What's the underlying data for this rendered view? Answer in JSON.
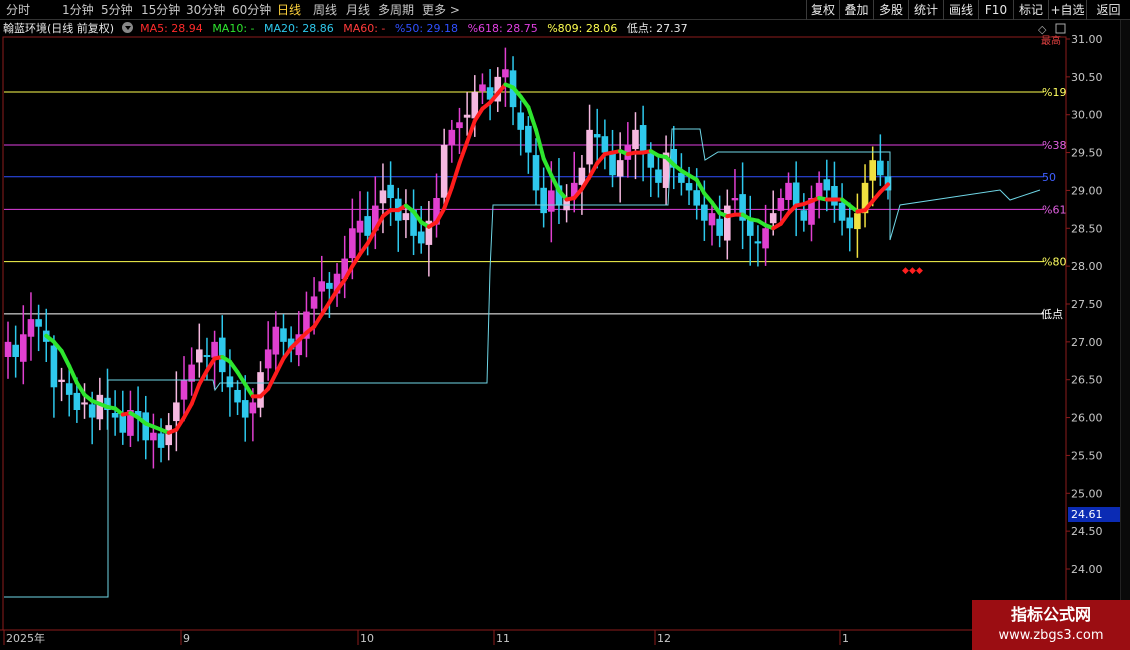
{
  "toolbar": {
    "periods": [
      "分时",
      "1分钟",
      "5分钟",
      "15分钟",
      "30分钟",
      "60分钟",
      "日线",
      "周线",
      "月线",
      "多周期",
      "更多 >"
    ],
    "active_period": "日线",
    "buttons": [
      "复权",
      "叠加",
      "多股",
      "统计",
      "画线",
      "F10",
      "标记",
      "+自选",
      "返回"
    ]
  },
  "legend": {
    "stock_name": "翰蓝环境(日线 前复权)",
    "ma5": "MA5: 28.94",
    "ma10": "MA10: -",
    "ma20": "MA20: 28.86",
    "ma60": "MA60: -",
    "pct50": "%50: 29.18",
    "pct618": "%618: 28.75",
    "pct809": "%809: 28.06",
    "low": "低点: 27.37"
  },
  "price_tag": "24.61",
  "watermark": {
    "title": "指标公式网",
    "url": "www.zbgs3.com"
  },
  "colors": {
    "up": "#e040d0",
    "up_light": "#f5b8e0",
    "down": "#2ec8ec",
    "ma_up": "#ff1c1c",
    "ma_down": "#2ee62e",
    "yellow_line": "#ffff50",
    "magenta_line": "#e040e0",
    "blue_line": "#3050ff",
    "white_line": "#ffffff",
    "step_line": "#6fd6e6",
    "axis_text": "#c8c8c8"
  },
  "chart_data": {
    "type": "candlestick",
    "y_axis_ticks": [
      31.0,
      30.5,
      30.0,
      29.5,
      29.0,
      28.5,
      28.0,
      27.5,
      27.0,
      26.5,
      26.0,
      25.5,
      25.0,
      24.5,
      24.0
    ],
    "ylim": [
      23.6,
      31.25
    ],
    "x_labels": [
      "2025年",
      "9",
      "10",
      "11",
      "12",
      "1"
    ],
    "levels": [
      {
        "label": "%19",
        "value": 30.3,
        "color": "yellow"
      },
      {
        "label": "%38",
        "value": 29.6,
        "color": "magenta"
      },
      {
        "label": "50",
        "value": 29.18,
        "color": "blue"
      },
      {
        "label": "%61",
        "value": 28.75,
        "color": "magenta"
      },
      {
        "label": "%80",
        "value": 28.06,
        "color": "yellow"
      },
      {
        "label": "低点",
        "value": 27.37,
        "color": "white"
      }
    ],
    "top_marker": "最高",
    "closes": [
      27.0,
      26.8,
      27.1,
      27.3,
      27.2,
      27.0,
      26.4,
      26.5,
      26.3,
      26.1,
      26.2,
      26.0,
      26.3,
      26.1,
      26.0,
      25.8,
      26.1,
      26.0,
      25.7,
      25.8,
      25.6,
      25.9,
      26.2,
      26.5,
      26.7,
      26.9,
      26.8,
      27.0,
      26.6,
      26.4,
      26.2,
      26.0,
      26.2,
      26.6,
      26.9,
      27.2,
      27.0,
      26.9,
      27.1,
      27.4,
      27.6,
      27.8,
      27.7,
      27.9,
      28.1,
      28.5,
      28.6,
      28.4,
      28.8,
      29.0,
      28.9,
      28.6,
      28.7,
      28.4,
      28.3,
      28.6,
      28.9,
      29.6,
      29.8,
      29.9,
      30.0,
      30.3,
      30.4,
      30.2,
      30.5,
      30.6,
      30.1,
      29.8,
      29.5,
      29.0,
      28.7,
      29.0,
      28.8,
      28.9,
      29.1,
      29.3,
      29.8,
      29.7,
      29.5,
      29.2,
      29.4,
      29.6,
      29.8,
      29.5,
      29.3,
      29.1,
      29.5,
      29.3,
      29.1,
      29.0,
      28.8,
      28.6,
      28.7,
      28.4,
      28.8,
      28.9,
      28.6,
      28.4,
      28.3,
      28.5,
      28.7,
      28.9,
      29.1,
      28.8,
      28.6,
      28.9,
      29.1,
      29.0,
      28.8,
      28.6,
      28.5,
      28.7,
      29.1,
      29.4,
      29.2,
      29.0
    ]
  }
}
